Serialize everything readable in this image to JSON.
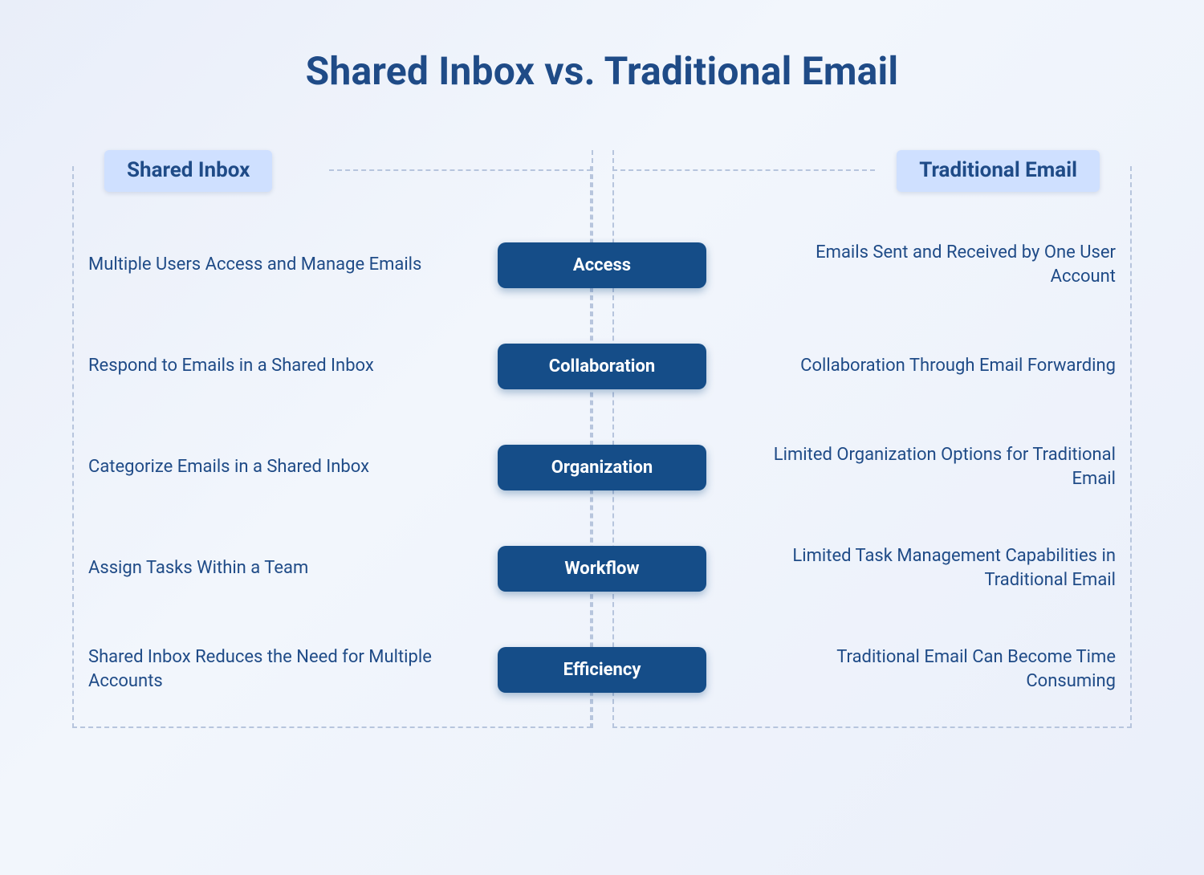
{
  "title": "Shared Inbox vs. Traditional Email",
  "left": {
    "header": "Shared Inbox",
    "items": [
      "Multiple Users Access and Manage Emails",
      "Respond to Emails in a Shared Inbox",
      "Categorize Emails in a Shared Inbox",
      "Assign Tasks Within a Team",
      "Shared Inbox Reduces the Need for Multiple Accounts"
    ]
  },
  "right": {
    "header": "Traditional Email",
    "items": [
      "Emails Sent and Received by One User Account",
      "Collaboration Through Email Forwarding",
      "Limited Organization Options for Traditional Email",
      "Limited Task Management Capabilities in Traditional Email",
      "Traditional Email Can Become Time Consuming"
    ]
  },
  "categories": [
    "Access",
    "Collaboration",
    "Organization",
    "Workflow",
    "Efficiency"
  ],
  "colors": {
    "brand_dark": "#154d88",
    "brand_text": "#1f4b87",
    "tab_bg": "#cfe0ff",
    "dash": "#b7c5dd"
  }
}
